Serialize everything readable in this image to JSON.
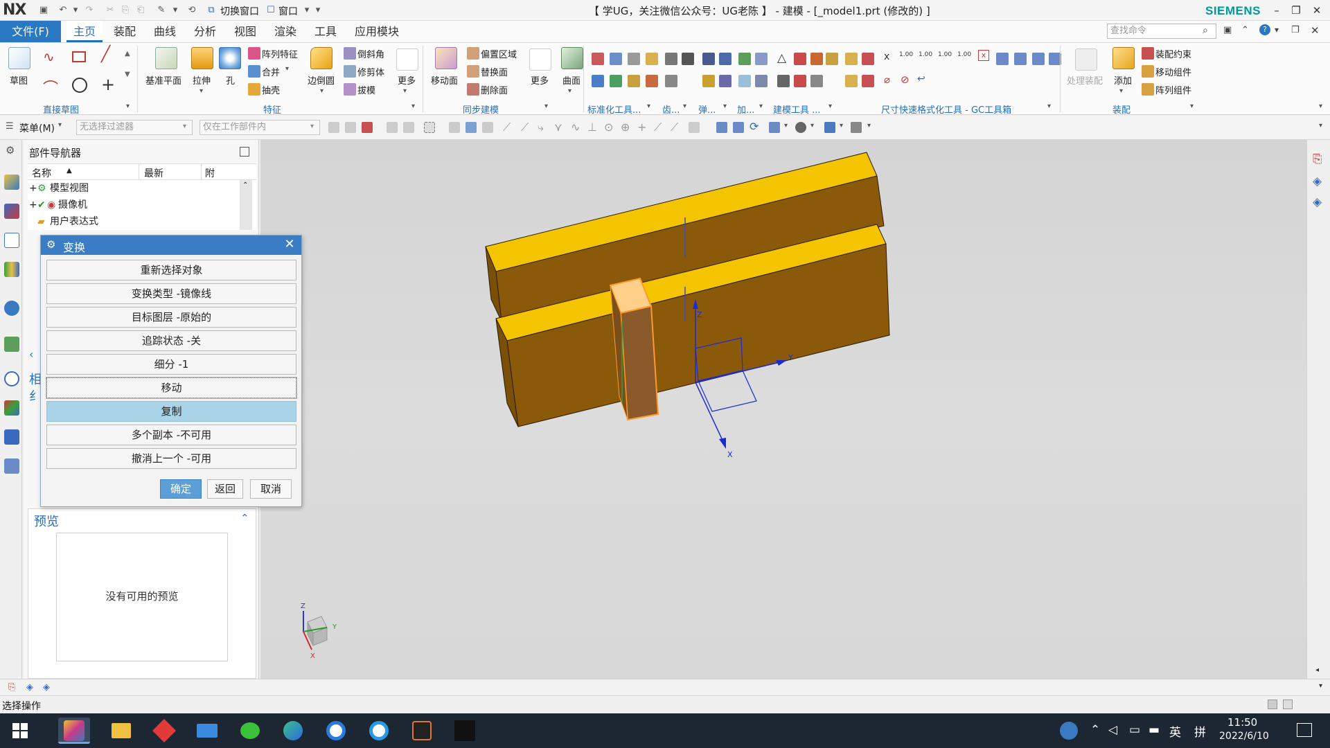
{
  "titlebar": {
    "logo": "NX",
    "title": "【 学UG，关注微信公众号：UG老陈 】 - 建模 - [_model1.prt  (修改的) ]",
    "switch_window": "切换窗口",
    "window_menu": "窗口",
    "brand": "SIEMENS"
  },
  "menubar": {
    "file": "文件(F)",
    "tabs": [
      "主页",
      "装配",
      "曲线",
      "分析",
      "视图",
      "渲染",
      "工具",
      "应用模块"
    ],
    "search_placeholder": "查找命令"
  },
  "ribbon": {
    "sketch": "草图",
    "direct_sketch_group": "直接草图",
    "datum_plane": "基准平面",
    "extrude": "拉伸",
    "hole": "孔",
    "pattern_feature": "阵列特征",
    "unite": "合并",
    "shell": "抽壳",
    "edge_blend": "边倒圆",
    "chamfer": "倒斜角",
    "trim_body": "修剪体",
    "draft": "拔模",
    "more": "更多",
    "feature_group": "特征",
    "move_face": "移动面",
    "offset_region": "偏置区域",
    "replace_face": "替换面",
    "delete_face": "删除面",
    "sync_group": "同步建模",
    "more2": "更多",
    "surface": "曲面",
    "std_tools_group": "标准化工具...",
    "gear_group": "齿...",
    "spring_group": "弹...",
    "add_group": "加...",
    "modeling_tools_group": "建模工具 ...",
    "dim_format_group": "尺寸快速格式化工具 - GC工具箱",
    "process_assembly": "处理装配",
    "add": "添加",
    "assembly_constraint": "装配约束",
    "move_component": "移动组件",
    "pattern_component": "阵列组件",
    "assembly_group": "装配",
    "dim_labels": [
      "1.00",
      "1.00",
      "1.00",
      "1.00"
    ]
  },
  "toolbar2": {
    "menu": "菜单(M)",
    "filter": "无选择过滤器",
    "scope": "仅在工作部件内"
  },
  "navigator": {
    "title": "部件导航器",
    "col_name": "名称",
    "col_latest": "最新",
    "col_attach": "附",
    "rows": [
      "模型视图",
      "摄像机",
      "用户表达式"
    ],
    "side_labels": [
      "相",
      "纟"
    ],
    "preview_title": "预览",
    "preview_empty": "没有可用的预览"
  },
  "dialog": {
    "title": "变换",
    "buttons": [
      "重新选择对象",
      "变换类型 -镜像线",
      "目标图层 -原始的",
      "追踪状态 -关",
      "细分 -1",
      "移动",
      "复制",
      "多个副本 -不可用",
      "撤消上一个 -可用"
    ],
    "ok": "确定",
    "back": "返回",
    "cancel": "取消"
  },
  "viewport": {
    "axis_x": "X",
    "axis_y": "Y",
    "axis_z": "Z",
    "triad_x": "X",
    "triad_y": "Y",
    "triad_z": "Z",
    "colors": {
      "top_face": "#f5c400",
      "front_face": "#8a5a0a",
      "side_face": "#7a4f08",
      "edge": "#2a1a00",
      "selected": "#ff9a2a",
      "csys": "#1a2bd4"
    }
  },
  "status": {
    "text": "选择操作"
  },
  "taskbar": {
    "time": "11:50",
    "date": "2022/6/10",
    "ime": "英",
    "ime2": "拼"
  }
}
